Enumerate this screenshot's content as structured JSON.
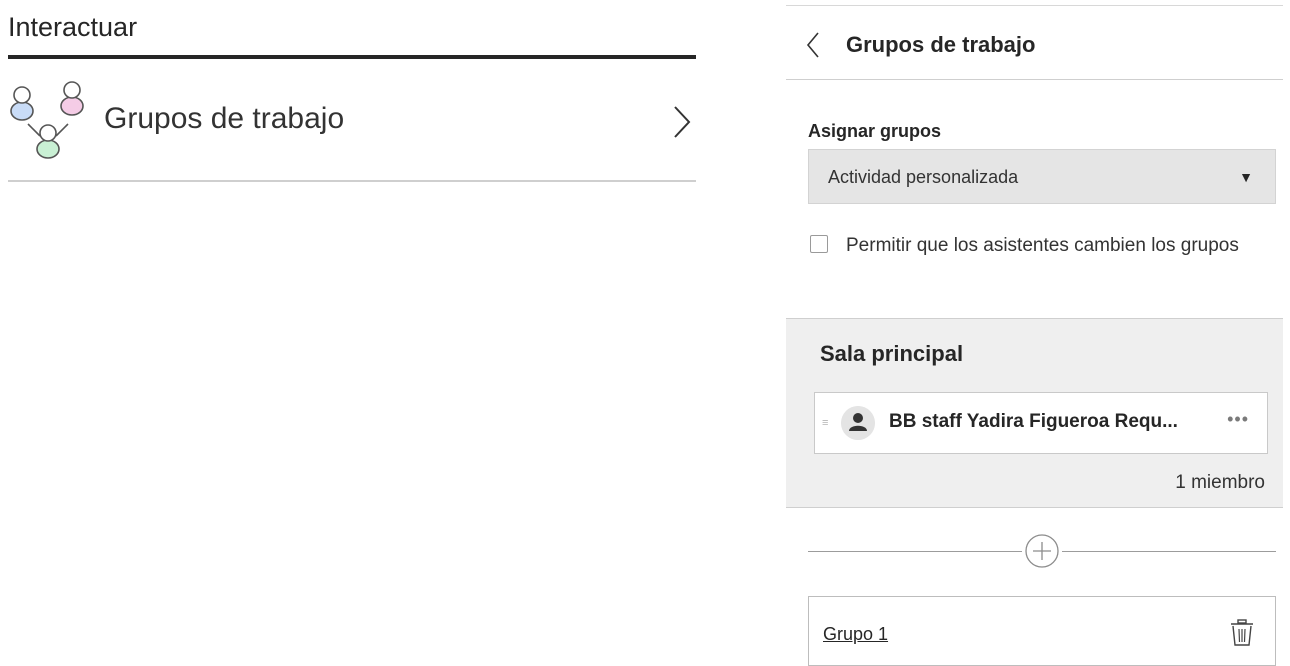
{
  "left": {
    "title": "Interactuar",
    "item_label": "Grupos de trabajo"
  },
  "right": {
    "header_title": "Grupos de trabajo",
    "assign_label": "Asignar grupos",
    "assign_value": "Actividad personalizada",
    "allow_change_label": "Permitir que los asistentes cambien los grupos",
    "allow_change_checked": false,
    "main_room": {
      "title": "Sala principal",
      "members": [
        {
          "name": "BB staff Yadira Figueroa Requ..."
        }
      ],
      "count": "1 miembro"
    },
    "groups": [
      {
        "name": "Grupo 1"
      }
    ]
  },
  "colors": {
    "text": "#262626",
    "rule_dark": "#262626",
    "panel_bg": "#efefef",
    "select_bg": "#e5e5e5",
    "icon_blue": "#c9dcf7",
    "icon_pink": "#f5cce6",
    "icon_green": "#c9f0d4"
  },
  "icons": [
    "group-people-icon",
    "chevron-right-icon",
    "chevron-left-icon",
    "caret-down-icon",
    "drag-handle-icon",
    "user-avatar-icon",
    "more-options-icon",
    "add-circle-icon",
    "trash-icon"
  ]
}
